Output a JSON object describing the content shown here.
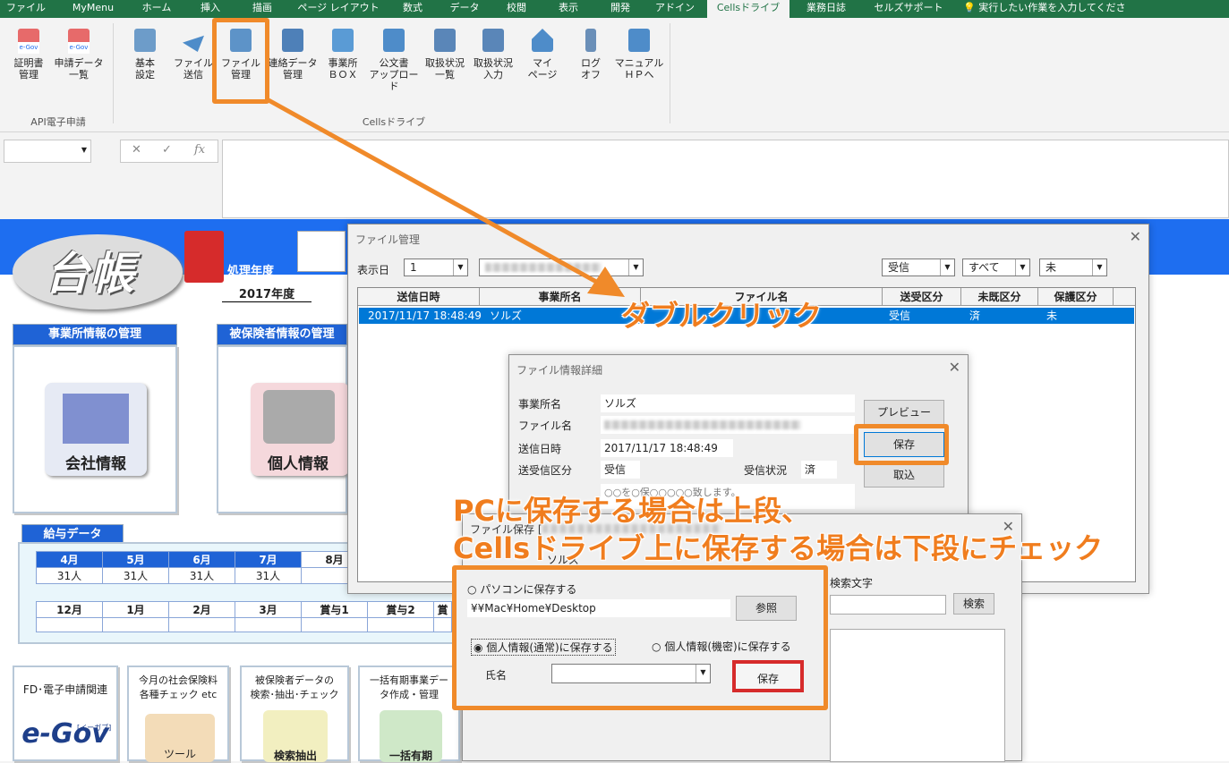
{
  "ribbon_tabs": [
    "ファイル",
    "MyMenu",
    "ホーム",
    "挿入",
    "描画",
    "ページ レイアウト",
    "数式",
    "データ",
    "校閲",
    "表示",
    "開発",
    "アドイン",
    "Cellsドライブ",
    "業務日誌",
    "セルズサポート",
    "実行したい作業を入力してください"
  ],
  "ribbon": {
    "buttons": [
      {
        "label": "証明書\n管理"
      },
      {
        "label": "申請データ\n一覧"
      },
      {
        "label": "基本\n設定"
      },
      {
        "label": "ファイル\n送信"
      },
      {
        "label": "ファイル\n管理"
      },
      {
        "label": "連絡データ\n管理"
      },
      {
        "label": "事業所\nＢＯＸ"
      },
      {
        "label": "公文書\nアップロード"
      },
      {
        "label": "取扱状況\n一覧"
      },
      {
        "label": "取扱状況\n入力"
      },
      {
        "label": "マイ\nページ"
      },
      {
        "label": "ログ\nオフ"
      },
      {
        "label": "マニュアル\nＨＰへ"
      }
    ],
    "group_api": "API電子申請",
    "group_cells": "Cellsドライブ",
    "egov_badge": "e-Gov"
  },
  "formula_bar": {
    "fx": "fx"
  },
  "sheet": {
    "logo": "台帳",
    "year_label": "処理年度",
    "year_value": "2017年度",
    "office_header": "事業所情報の管理",
    "insured_header": "被保険者情報の管理",
    "company_btn": "会社情報",
    "person_btn": "個人情報",
    "salary_header": "給与データ",
    "months1": [
      "4月",
      "5月",
      "6月",
      "7月",
      "8月"
    ],
    "counts1": [
      "31人",
      "31人",
      "31人",
      "31人",
      ""
    ],
    "months2": [
      "12月",
      "1月",
      "2月",
      "3月",
      "賞与1",
      "賞与2",
      "賞"
    ],
    "bottom_cards": [
      "FD･電子申請関連",
      "今月の社会保険料\n各種チェック etc",
      "被保険者データの\n検索･抽出･チェック",
      "一括有期事業デー\nタ作成・管理"
    ],
    "egov_logo": "e-Gov",
    "egov_kana": "[イーガブ]",
    "card_caption2": "ツール",
    "card_caption3": "検索抽出",
    "card_caption4": "一括有期"
  },
  "file_mgmt": {
    "title": "ファイル管理",
    "display_day_label": "表示日",
    "display_day_value": "1",
    "filter1": "受信",
    "filter2": "すべて",
    "filter3": "未",
    "columns": [
      "送信日時",
      "事業所名",
      "ファイル名",
      "送受区分",
      "未既区分",
      "保護区分"
    ],
    "row": {
      "date": "2017/11/17 18:48:49",
      "office": "ソルズ",
      "dir": "受信",
      "read": "済",
      "protect": "未"
    }
  },
  "file_detail": {
    "title": "ファイル情報詳細",
    "office_label": "事業所名",
    "office_value": "ソルズ",
    "file_label": "ファイル名",
    "date_label": "送信日時",
    "date_value": "2017/11/17 18:48:49",
    "dir_label": "送受信区分",
    "dir_value": "受信",
    "status_label": "受信状況",
    "status_value": "済",
    "preview_btn": "プレビュー",
    "save_btn": "保存",
    "import_btn": "取込",
    "memo_partial": "○○を○保○○○○○致します。"
  },
  "file_save": {
    "title": "ファイル保存 [",
    "office_partial": "ソルズ",
    "opt_pc": "パソコンに保存する",
    "path": "¥¥Mac¥Home¥Desktop",
    "browse_btn": "参照",
    "opt_normal": "個人情報(通常)に保存する",
    "opt_secret": "個人情報(機密)に保存する",
    "name_label": "氏名",
    "save_btn": "保存",
    "search_label": "検索文字",
    "search_btn": "検索"
  },
  "annotations": {
    "double_click": "ダブルクリック",
    "line1": "PCに保存する場合は上段、",
    "line2": "Cellsドライブ上に保存する場合は下段にチェック"
  },
  "colors": {
    "excel_green": "#217346",
    "accent_orange": "#f08a2a",
    "highlight_red": "#d62b2b",
    "selection_blue": "#0078d7"
  }
}
